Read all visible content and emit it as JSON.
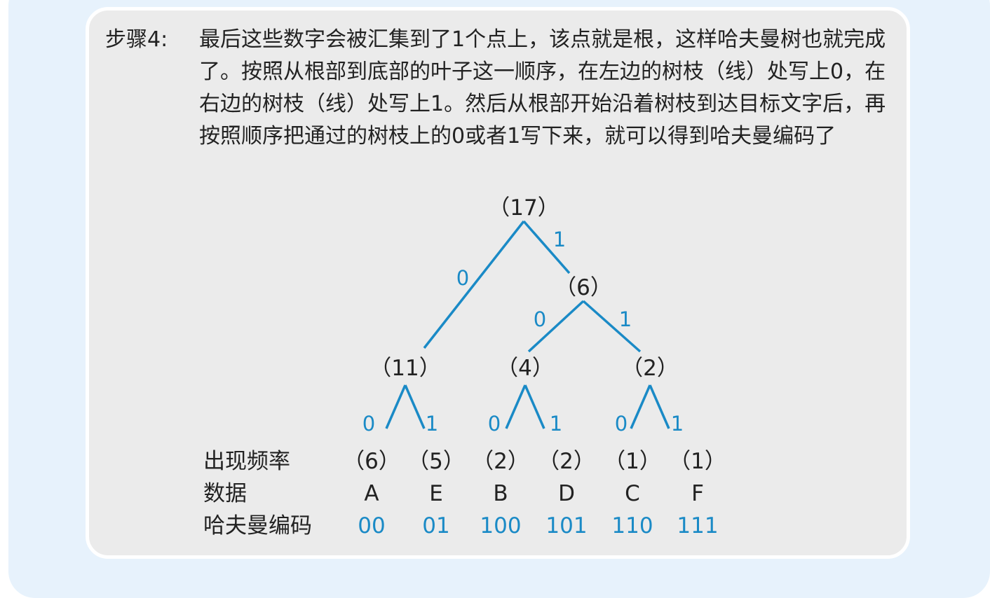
{
  "step": {
    "label": "步骤4:",
    "text": "最后这些数字会被汇集到了1个点上，该点就是根，这样哈夫曼树也就完成了。按照从根部到底部的叶子这一顺序，在左边的树枝（线）处写上0，在右边的树枝（线）处写上1。然后从根部开始沿着树枝到达目标文字后，再按照顺序把通过的树枝上的0或者1写下来，就可以得到哈夫曼编码了"
  },
  "tree": {
    "nodes": [
      {
        "id": "root",
        "label": "（17）"
      },
      {
        "id": "n6",
        "label": "（6）"
      },
      {
        "id": "n11",
        "label": "（11）"
      },
      {
        "id": "n4",
        "label": "（4）"
      },
      {
        "id": "n2",
        "label": "（2）"
      }
    ],
    "edges": [
      {
        "from": "root",
        "to": "n11",
        "bit": "0"
      },
      {
        "from": "root",
        "to": "n6",
        "bit": "1"
      },
      {
        "from": "n6",
        "to": "n4",
        "bit": "0"
      },
      {
        "from": "n6",
        "to": "n2",
        "bit": "1"
      },
      {
        "from": "n11",
        "to": "A",
        "bit": "0"
      },
      {
        "from": "n11",
        "to": "E",
        "bit": "1"
      },
      {
        "from": "n4",
        "to": "B",
        "bit": "0"
      },
      {
        "from": "n4",
        "to": "D",
        "bit": "1"
      },
      {
        "from": "n2",
        "to": "C",
        "bit": "0"
      },
      {
        "from": "n2",
        "to": "F",
        "bit": "1"
      }
    ]
  },
  "table": {
    "row_labels": {
      "frequency": "出现频率",
      "data": "数据",
      "code": "哈夫曼编码"
    },
    "leaves": [
      {
        "id": "A",
        "frequency": "（6）",
        "data": "A",
        "code": "00"
      },
      {
        "id": "E",
        "frequency": "（5）",
        "data": "E",
        "code": "01"
      },
      {
        "id": "B",
        "frequency": "（2）",
        "data": "B",
        "code": "100"
      },
      {
        "id": "D",
        "frequency": "（2）",
        "data": "D",
        "code": "101"
      },
      {
        "id": "C",
        "frequency": "（1）",
        "data": "C",
        "code": "110"
      },
      {
        "id": "F",
        "frequency": "（1）",
        "data": "F",
        "code": "111"
      }
    ]
  },
  "colors": {
    "accent": "#1a8ac6",
    "text": "#222222",
    "panel": "#ebebeb",
    "outer": "#e7f2fc"
  }
}
